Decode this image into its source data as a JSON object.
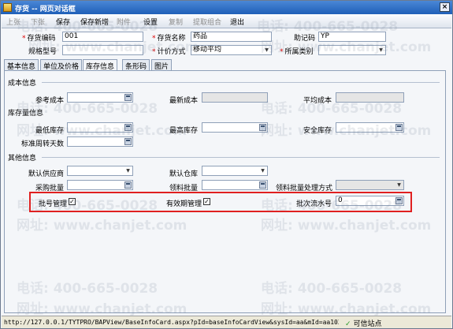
{
  "window": {
    "title": "存货  -- 网页对话框",
    "close": "×"
  },
  "toolbar": {
    "items": [
      {
        "label": "上张",
        "enabled": false
      },
      {
        "label": "下张",
        "enabled": false
      },
      {
        "label": "保存",
        "enabled": true
      },
      {
        "label": "保存新增",
        "enabled": true
      },
      {
        "label": "附件",
        "enabled": false
      },
      {
        "label": "设置",
        "enabled": true
      },
      {
        "label": "复制",
        "enabled": false
      },
      {
        "label": "提取组合",
        "enabled": false
      },
      {
        "label": "退出",
        "enabled": true
      }
    ]
  },
  "header": {
    "code_label": "存货编码",
    "code_value": "001",
    "name_label": "存货名称",
    "name_value": "药品",
    "mnemonic_label": "助记码",
    "mnemonic_value": "YP",
    "spec_label": "规格型号",
    "spec_value": "",
    "pricing_label": "计价方式",
    "pricing_value": "移动平均",
    "category_label": "所属类别",
    "category_value": ""
  },
  "tabs": [
    "基本信息",
    "单位及价格",
    "库存信息",
    "条形码",
    "图片"
  ],
  "stock": {
    "cost_section": "成本信息",
    "ref_cost_label": "参考成本",
    "ref_cost_value": "",
    "latest_cost_label": "最新成本",
    "latest_cost_value": "",
    "avg_cost_label": "平均成本",
    "avg_cost_value": "",
    "qty_section": "库存量信息",
    "min_stock_label": "最低库存",
    "min_stock_value": "",
    "max_stock_label": "最高库存",
    "max_stock_value": "",
    "safe_stock_label": "安全库存",
    "safe_stock_value": "",
    "turnover_label": "标准周转天数",
    "turnover_value": "",
    "other_section": "其他信息",
    "supplier_label": "默认供应商",
    "supplier_value": "",
    "warehouse_label": "默认仓库",
    "warehouse_value": "",
    "purchase_batch_label": "采购批量",
    "purchase_batch_value": "",
    "pick_batch_label": "领料批量",
    "pick_batch_value": "",
    "pick_method_label": "领料批量处理方式",
    "pick_method_value": "",
    "batch_mgmt_label": "批号管理",
    "batch_mgmt_checked": true,
    "expiry_mgmt_label": "有效期管理",
    "expiry_mgmt_checked": true,
    "batch_seq_label": "批次流水号",
    "batch_seq_value": "0"
  },
  "status": {
    "url": "http://127.0.0.1/TYTPRO/BAPView/BaseInfoCard.aspx?pId=baseInfoCardView&sysId=aa&mId=aa1022&NodeV",
    "zone": "可信站点"
  },
  "watermark": {
    "phone": "电话: 400-665-0028",
    "site": "网址: www.chanjet.com"
  },
  "colors": {
    "highlight_box": "#e02020",
    "title_bar": "#1f5fb8"
  }
}
